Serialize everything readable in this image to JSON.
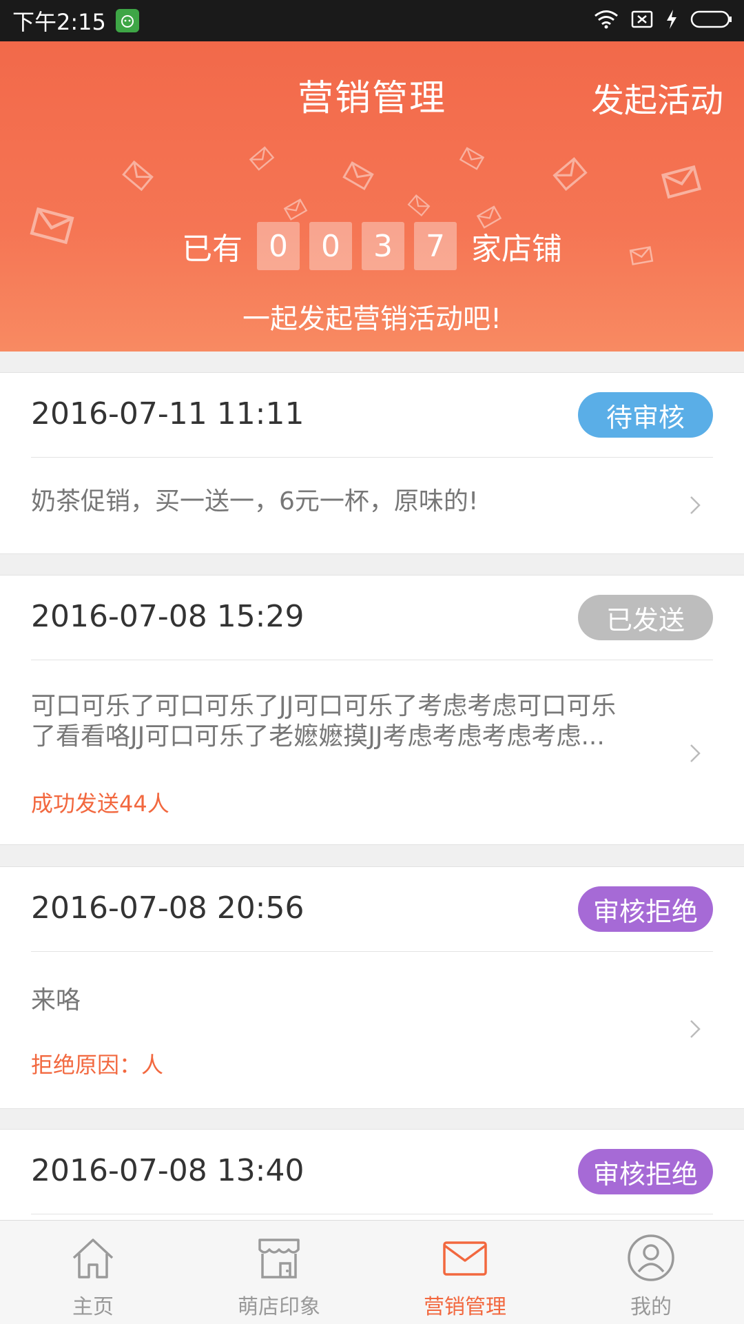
{
  "status_bar": {
    "time": "下午2:15"
  },
  "header": {
    "title": "营销管理",
    "action": "发起活动",
    "counter_prefix": "已有",
    "digits": [
      "0",
      "0",
      "3",
      "7"
    ],
    "counter_suffix": "家店铺",
    "subtitle": "一起发起营销活动吧!"
  },
  "activities": [
    {
      "date": "2016-07-11 11:11",
      "status": "待审核",
      "status_color": "#5aaee7",
      "content": "奶茶促销，买一送一，6元一杯，原味的!",
      "note": ""
    },
    {
      "date": "2016-07-08 15:29",
      "status": "已发送",
      "status_color": "#bdbdbd",
      "content_line1": "可口可乐了可口可乐了JJ可口可乐了考虑考虑可口可乐",
      "content_line2": "了看看咯JJ可口可乐了老嬷嬷摸JJ考虑考虑考虑考虑...",
      "note": "成功发送44人"
    },
    {
      "date": "2016-07-08 20:56",
      "status": "审核拒绝",
      "status_color": "#a66ad6",
      "content": "来咯",
      "note": "拒绝原因：人"
    },
    {
      "date": "2016-07-08 13:40",
      "status": "审核拒绝",
      "status_color": "#a66ad6"
    }
  ],
  "tabs": [
    {
      "label": "主页",
      "icon": "home-icon"
    },
    {
      "label": "萌店印象",
      "icon": "store-icon"
    },
    {
      "label": "营销管理",
      "icon": "mail-icon",
      "active": true
    },
    {
      "label": "我的",
      "icon": "user-icon"
    }
  ],
  "colors": {
    "accent": "#f2683f",
    "header": "#f57554"
  }
}
